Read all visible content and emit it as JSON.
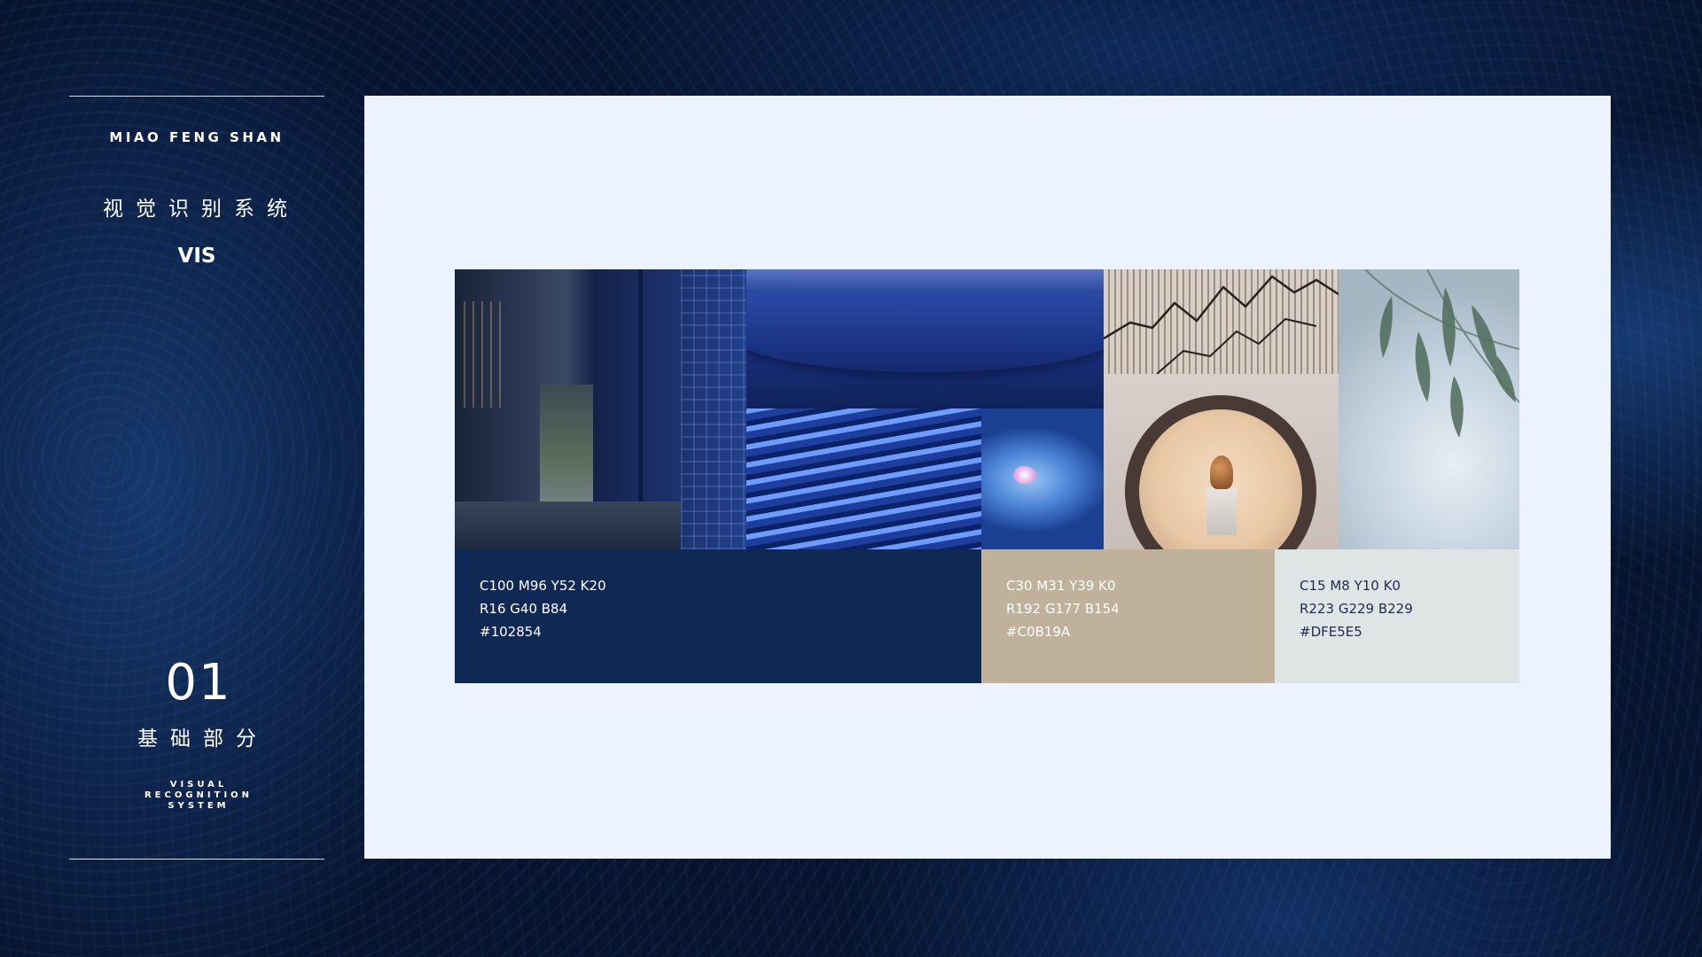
{
  "sidebar": {
    "brand": "MIAO FENG SHAN",
    "title_cn": "视觉识别系统",
    "title_en": "VIS",
    "section_number": "01",
    "section_cn": "基础部分",
    "system_lines": [
      "VISUAL",
      "RECOGNITION",
      "SYSTEM"
    ]
  },
  "swatches": [
    {
      "cmyk": "C100 M96 Y52 K20",
      "rgb": "R16 G40 B84",
      "hex": "#102854",
      "color": "#102854"
    },
    {
      "cmyk": "C30 M31 Y39 K0",
      "rgb": "R192 G177 B154",
      "hex": "#C0B19A",
      "color": "#C0B19A"
    },
    {
      "cmyk": "C15 M8 Y10 K0",
      "rgb": "R223 G229 B229",
      "hex": "#DFE5E5",
      "color": "#DFE5E5"
    }
  ],
  "moodboard": [
    "dark-lattice-wall-photo",
    "blue-curved-wall-photo",
    "blue-wave-roof-tiles-photo",
    "blue-bowl-flower-photo",
    "wood-slats-branch-photo",
    "moon-gate-statue-photo",
    "bamboo-mist-photo"
  ]
}
